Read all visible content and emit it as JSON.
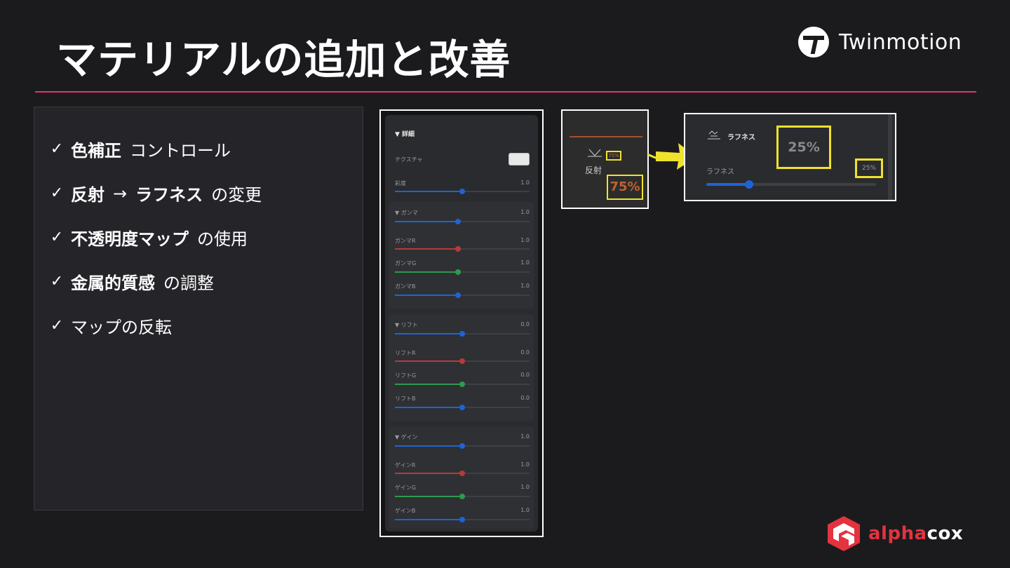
{
  "slide": {
    "title": "マテリアルの追加と改善",
    "brand_name": "Twinmotion",
    "footer_brand_alpha": "alpha",
    "footer_brand_cox": "cox",
    "accent_color": "#e0356c"
  },
  "bullets": [
    {
      "check": "✓",
      "strong": "色補正",
      "normal": "コントロール"
    },
    {
      "check": "✓",
      "strong": "反射",
      "arrow": "→",
      "strong2": "ラフネス",
      "normal": "の変更"
    },
    {
      "check": "✓",
      "strong": "不透明度マップ",
      "normal": "の使用"
    },
    {
      "check": "✓",
      "strong": "金属的質感",
      "normal": "の調整"
    },
    {
      "check": "✓",
      "strong": "",
      "normal": "マップの反転"
    }
  ],
  "ui_panel": {
    "header": "▼ 詳細",
    "texture_label": "テクスチャ",
    "saturation": {
      "label": "彩度",
      "value": "1.0",
      "level": 0.5
    },
    "gamma_group": {
      "label": "▼ ガンマ",
      "value": "1.0",
      "level": 0.47,
      "items": [
        {
          "label": "ガンマR",
          "value": "1.0",
          "level": 0.47,
          "color": "#b63a3a"
        },
        {
          "label": "ガンマG",
          "value": "1.0",
          "level": 0.47,
          "color": "#2e9a4f"
        },
        {
          "label": "ガンマB",
          "value": "1.0",
          "level": 0.47,
          "color": "#1e63d6"
        }
      ]
    },
    "lift_group": {
      "label": "▼ リフト",
      "value": "0.0",
      "level": 0.5,
      "items": [
        {
          "label": "リフトR",
          "value": "0.0",
          "level": 0.5,
          "color": "#b63a3a"
        },
        {
          "label": "リフトG",
          "value": "0.0",
          "level": 0.5,
          "color": "#2e9a4f"
        },
        {
          "label": "リフトB",
          "value": "0.0",
          "level": 0.5,
          "color": "#1e63d6"
        }
      ]
    },
    "gain_group": {
      "label": "▼ ゲイン",
      "value": "1.0",
      "level": 0.5,
      "items": [
        {
          "label": "ゲインR",
          "value": "1.0",
          "level": 0.5,
          "color": "#b63a3a"
        },
        {
          "label": "ゲインG",
          "value": "1.0",
          "level": 0.5,
          "color": "#2e9a4f"
        },
        {
          "label": "ゲインB",
          "value": "1.0",
          "level": 0.5,
          "color": "#1e63d6"
        }
      ]
    }
  },
  "reflection": {
    "label": "反射",
    "small_value": "75%",
    "big_value": "75%"
  },
  "roughness": {
    "title": "ラフネス",
    "slider_label": "ラフネス",
    "small_value": "25%",
    "big_value": "25%",
    "level": 0.25
  }
}
